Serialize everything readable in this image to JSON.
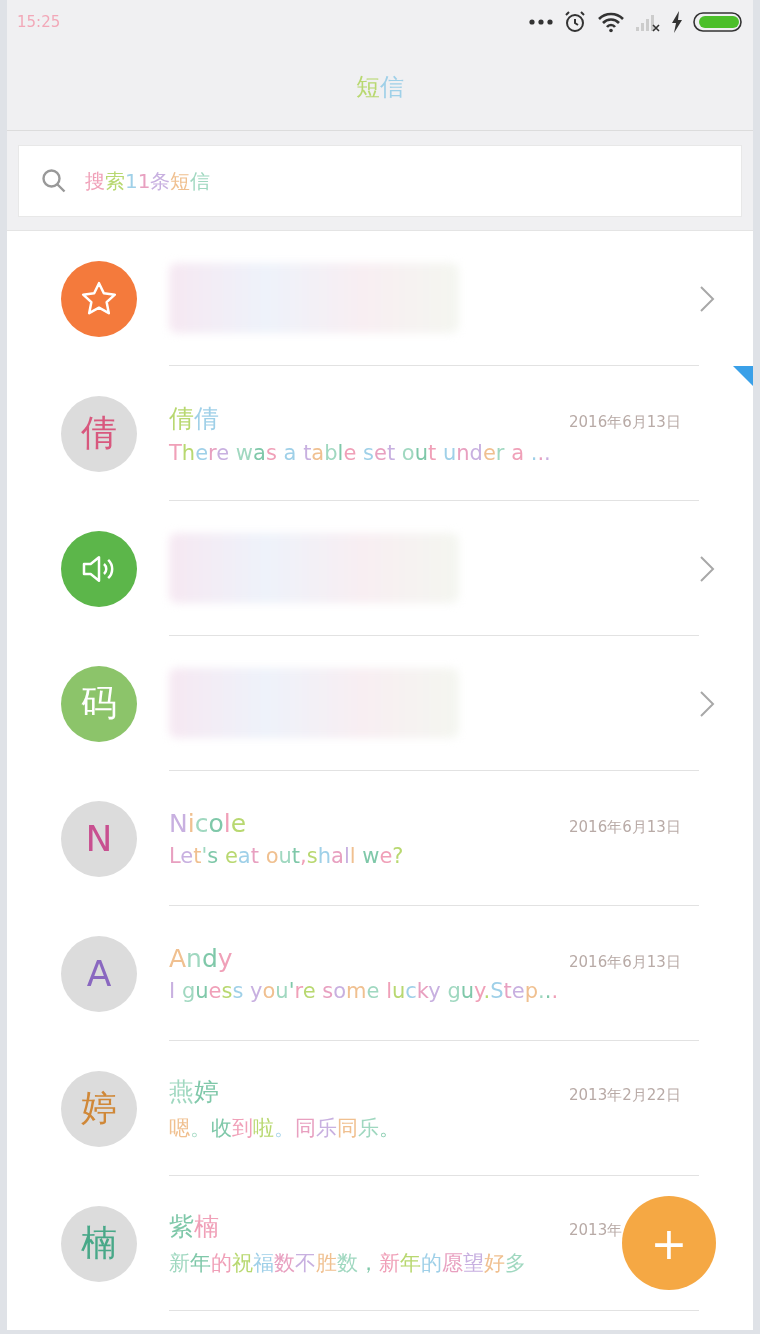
{
  "status_bar": {
    "time": "15:25"
  },
  "header": {
    "title": "短信"
  },
  "search": {
    "placeholder": "搜索11条短信"
  },
  "conversations": [
    {
      "kind": "blurred",
      "avatar": {
        "kind": "star",
        "color": "#f47a3c"
      },
      "unread": false
    },
    {
      "kind": "message",
      "avatar": {
        "kind": "letter",
        "text": "倩"
      },
      "name": "倩倩",
      "date": "2016年6月13日",
      "preview": "There was a table set out under a ...",
      "unread": true
    },
    {
      "kind": "blurred",
      "avatar": {
        "kind": "speaker",
        "color": "#5cb64a"
      },
      "unread": false
    },
    {
      "kind": "blurred",
      "avatar": {
        "kind": "letter",
        "text": "码",
        "color": "#8cc46a"
      },
      "unread": false
    },
    {
      "kind": "message",
      "avatar": {
        "kind": "letter",
        "text": "N"
      },
      "name": "Nicole",
      "date": "2016年6月13日",
      "preview": "Let's eat out,shall we?",
      "unread": false
    },
    {
      "kind": "message",
      "avatar": {
        "kind": "letter",
        "text": "A"
      },
      "name": "Andy",
      "date": "2016年6月13日",
      "preview": "I guess you're some lucky guy.Step...",
      "unread": false
    },
    {
      "kind": "message",
      "avatar": {
        "kind": "letter",
        "text": "婷"
      },
      "name": "燕婷",
      "date": "2013年2月22日",
      "preview": "嗯。收到啦。同乐同乐。",
      "unread": false
    },
    {
      "kind": "message",
      "avatar": {
        "kind": "letter",
        "text": "楠"
      },
      "name": "紫楠",
      "date": "2013年",
      "preview": "新年的祝福数不胜数，新年的愿望好多",
      "unread": false
    }
  ],
  "fab": {
    "label": "+"
  }
}
